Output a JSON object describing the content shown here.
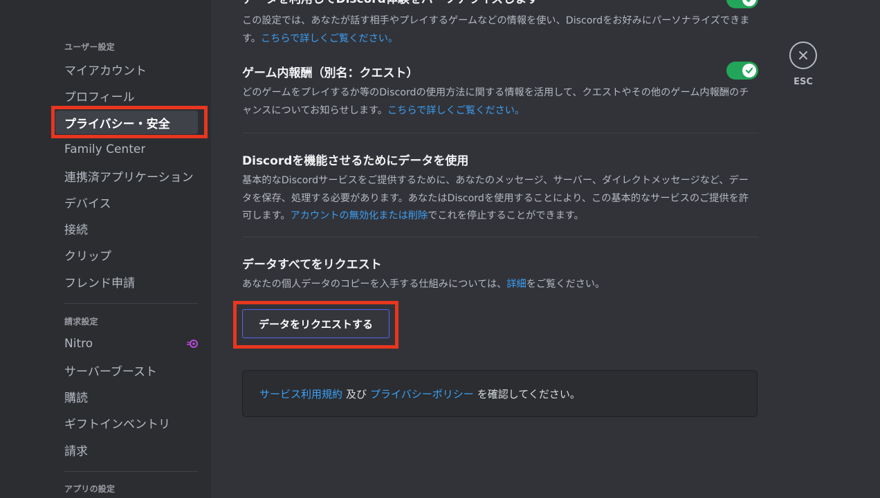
{
  "sidebar": {
    "user_settings_header": "ユーザー設定",
    "user_items": [
      "マイアカウント",
      "プロフィール",
      "プライバシー・安全",
      "Family Center",
      "連携済アプリケーション",
      "デバイス",
      "接続",
      "クリップ",
      "フレンド申請"
    ],
    "selected_item": "プライバシー・安全",
    "billing_header": "請求設定",
    "billing_items": [
      "Nitro",
      "サーバーブースト",
      "購読",
      "ギフトインベントリ",
      "請求"
    ],
    "app_settings_header": "アプリの設定"
  },
  "main": {
    "personalize": {
      "title": "データを利用してDiscord体験をパーソナライズします",
      "desc": "この設定では、あなたが話す相手やプレイするゲームなどの情報を使い、Discordをお好みにパーソナライズできます。",
      "link": "こちらで詳しくご覧ください。",
      "enabled": true
    },
    "quests": {
      "title": "ゲーム内報酬（別名：クエスト）",
      "desc": "どのゲームをプレイするか等のDiscordの使用方法に関する情報を活用して、クエストやその他のゲーム内報酬のチャンスについてお知らせします。",
      "link": "こちらで詳しくご覧ください。",
      "enabled": true
    },
    "functional": {
      "title": "Discordを機能させるためにデータを使用",
      "desc_before": "基本的なDiscordサービスをご提供するために、あなたのメッセージ、サーバー、ダイレクトメッセージなど、データを保存、処理する必要があります。あなたはDiscordを使用することにより、この基本的なサービスのご提供を許可します。",
      "link": "アカウントの無効化または削除",
      "desc_after": "でこれを停止することができます。"
    },
    "request": {
      "title": "データすべてをリクエスト",
      "desc_before": "あなたの個人データのコピーを入手する仕組みについては、",
      "link": "詳細",
      "desc_after": "をご覧ください。",
      "button": "データをリクエストする"
    },
    "terms": {
      "tos_link": "サービス利用規約",
      "and": "及び",
      "privacy_link": "プライバシーポリシー",
      "suffix": "を確認してください。"
    }
  },
  "close": {
    "label": "ESC"
  },
  "colors": {
    "accent_link": "#3ca0f5",
    "toggle_on": "#23a55a",
    "highlight": "#e8361f",
    "button_border": "#5865f2",
    "nitro": "#b94bdb"
  }
}
